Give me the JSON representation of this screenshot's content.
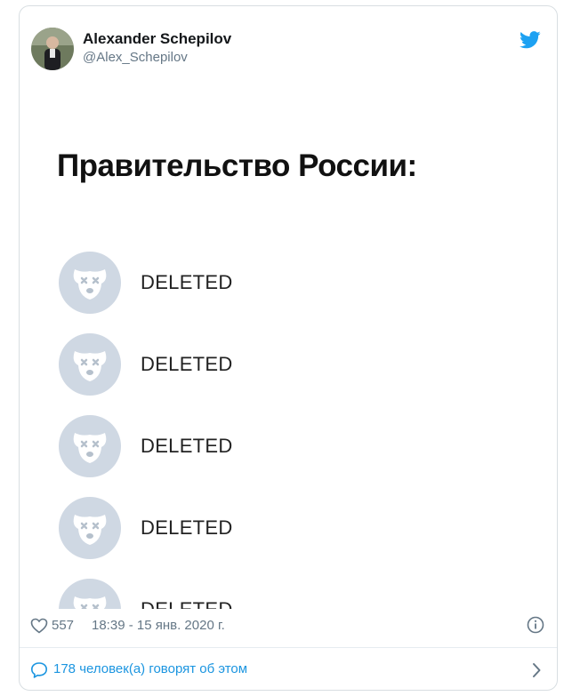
{
  "author": {
    "name": "Alexander Schepilov",
    "handle": "@Alex_Schepilov"
  },
  "media": {
    "title": "Правительство России:",
    "entries": [
      {
        "label": "DELETED"
      },
      {
        "label": "DELETED"
      },
      {
        "label": "DELETED"
      },
      {
        "label": "DELETED"
      },
      {
        "label": "DELETED"
      }
    ]
  },
  "meta": {
    "likes": "557",
    "timestamp": "18:39 - 15 янв. 2020 г."
  },
  "footer": {
    "conversation": "178 человек(а) говорят об этом"
  },
  "colors": {
    "accent": "#1da1f2",
    "link": "#1b95e0",
    "muted": "#657786",
    "placeholder_avatar": "#cfd8e3"
  },
  "icons": [
    "twitter-bird-icon",
    "heart-icon",
    "info-icon",
    "comment-icon",
    "chevron-right-icon",
    "deleted-user-dog-icon"
  ]
}
